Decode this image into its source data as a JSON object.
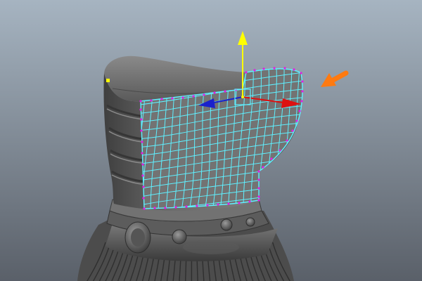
{
  "viewport": {
    "background_top": "#a6b4c1",
    "background_bottom": "#5a6069"
  },
  "model": {
    "surface_color": "#6c6c6c",
    "surface_shadow": "#3f3f3f",
    "surface_highlight": "#9a9a9a"
  },
  "selection": {
    "wireframe_color": "#5ff0ff",
    "vertex_color": "#e020e0",
    "pivot_point_color": "#ffff00"
  },
  "manipulator": {
    "y_axis_color": "#ffff00",
    "x_axis_color": "#dd1111",
    "z_axis_color": "#1a22cc",
    "center_handle_color": "#5ff0ff"
  },
  "annotation": {
    "arrow_color": "#ff7a10"
  }
}
